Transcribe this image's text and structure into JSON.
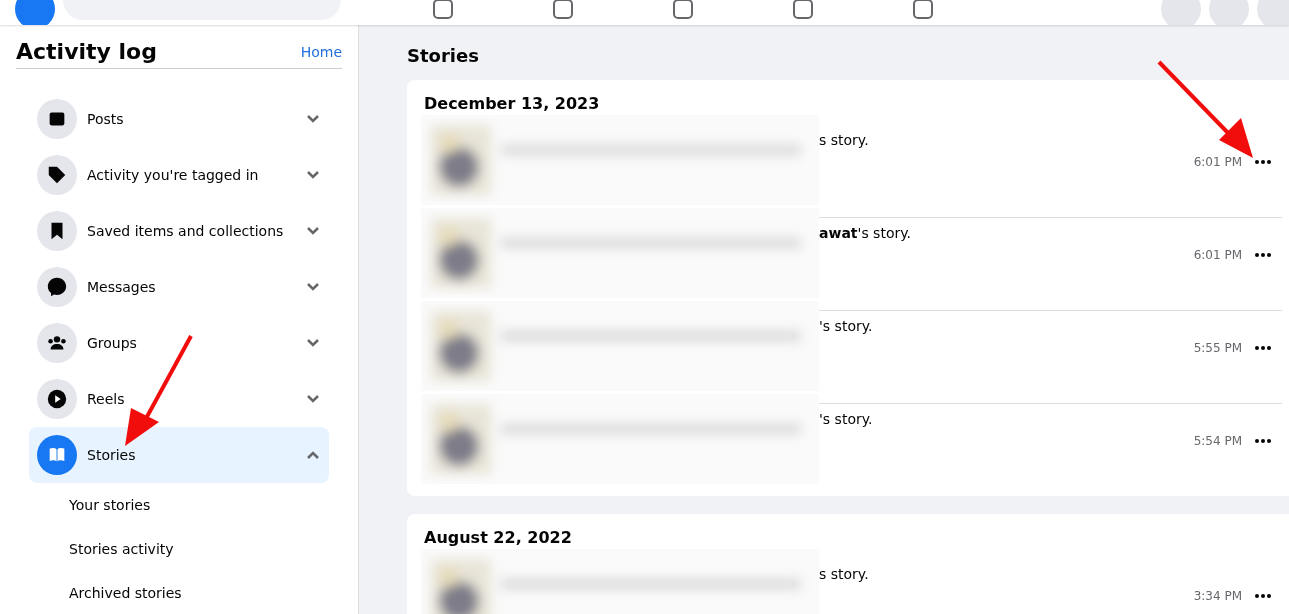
{
  "sidebar": {
    "title": "Activity log",
    "home_link": "Home",
    "items": [
      {
        "label": "Posts",
        "expanded": false,
        "selected": false
      },
      {
        "label": "Activity you're tagged in",
        "expanded": false,
        "selected": false
      },
      {
        "label": "Saved items and collections",
        "expanded": false,
        "selected": false
      },
      {
        "label": "Messages",
        "expanded": false,
        "selected": false
      },
      {
        "label": "Groups",
        "expanded": false,
        "selected": false
      },
      {
        "label": "Reels",
        "expanded": false,
        "selected": false
      },
      {
        "label": "Stories",
        "expanded": true,
        "selected": true,
        "children": [
          {
            "label": "Your stories"
          },
          {
            "label": "Stories activity"
          },
          {
            "label": "Archived stories"
          }
        ]
      }
    ]
  },
  "main": {
    "title": "Stories",
    "groups": [
      {
        "date": "December 13, 2023",
        "entries": [
          {
            "text": "s story.",
            "time": "6:01 PM"
          },
          {
            "text": "**awat**'s story.",
            "time": "6:01 PM"
          },
          {
            "text": "'s story.",
            "time": "5:55 PM"
          },
          {
            "text": "'s story.",
            "time": "5:54 PM"
          }
        ]
      },
      {
        "date": "August 22, 2022",
        "entries": [
          {
            "text": "s story.",
            "time": "3:34 PM"
          }
        ]
      }
    ]
  }
}
